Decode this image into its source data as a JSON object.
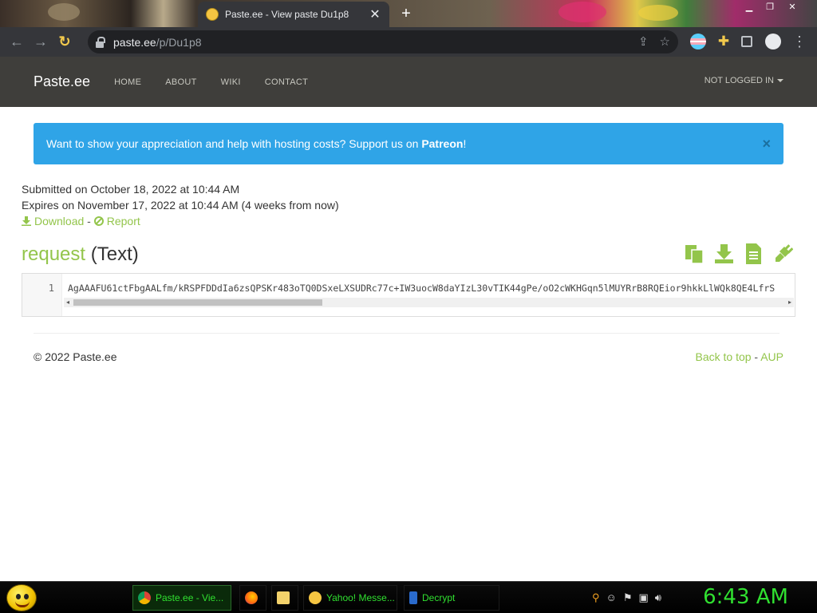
{
  "browser": {
    "tab_title": "Paste.ee - View paste Du1p8",
    "tab_close": "✕",
    "new_tab": "+",
    "url_host": "paste.ee",
    "url_path": "/p/Du1p8"
  },
  "site": {
    "brand": "Paste.ee",
    "nav": [
      "HOME",
      "ABOUT",
      "WIKI",
      "CONTACT"
    ],
    "login": "NOT LOGGED IN"
  },
  "alert": {
    "text": "Want to show your appreciation and help with hosting costs? Support us on ",
    "link": "Patreon",
    "suffix": "!",
    "close": "×"
  },
  "meta": {
    "submitted": "Submitted on October 18, 2022 at 10:44 AM",
    "expires": "Expires on November 17, 2022 at 10:44 AM (4 weeks from now)",
    "download": "Download",
    "separator": " - ",
    "report": "Report"
  },
  "paste": {
    "name": "request",
    "type": " (Text)",
    "line_number": "1",
    "content": "AgAAAFU61ctFbgAALfm/kRSPFDDdIa6zsQPSKr483oTQ0DSxeLXSUDRc77c+IW3uocW8daYIzL30vTIK44gPe/oO2cWKHGqn5lMUYRrB8RQEior9hkkLlWQk8QE4LfrS"
  },
  "footer": {
    "copyright": "© 2022 Paste.ee",
    "back_to_top": "Back to top",
    "separator": " - ",
    "aup": "AUP"
  },
  "taskbar": {
    "items": [
      "Paste.ee - Vie...",
      "Yahoo! Messe...",
      "Decrypt"
    ],
    "clock": "6:43 AM"
  }
}
